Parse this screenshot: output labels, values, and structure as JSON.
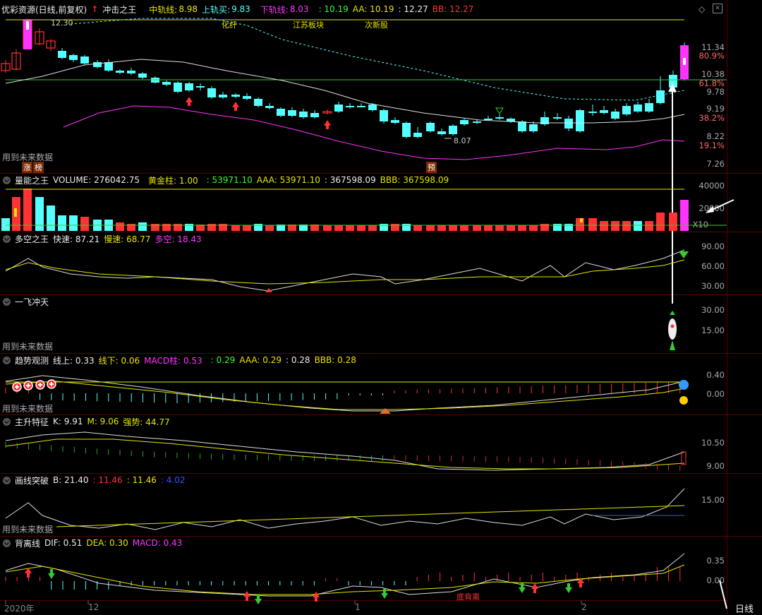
{
  "main": {
    "title": "优彩资源(日线,前复权)",
    "indicator": "冲击之王",
    "mid_label": "中轨线:",
    "mid_val": "8.98",
    "up_label": "上轨买:",
    "up_val": "9.83",
    "down_label": "下轨线:",
    "down_val": "8.03",
    "v1": ": 10.19",
    "aa": "AA: 10.19",
    "v2": ": 12.27",
    "bb": "BB: 12.27",
    "future_text": "用到未来数据",
    "annot_high": "12.30",
    "annot_low": "8.07",
    "tags": [
      "化纤",
      "江苏板块",
      "次新股"
    ],
    "badge1": "涨",
    "badge2": "榜",
    "badge3": "预",
    "y_labels": [
      "11.34",
      "10.38",
      "9.78",
      "9.19",
      "8.22",
      "7.26"
    ],
    "pct_labels": [
      "80.9%",
      "61.8%",
      "38.2%",
      "19.1%"
    ]
  },
  "volume": {
    "name": "量能之王",
    "vol_label": "VOLUME: 276042.75",
    "gold_label": "黄金柱: 1.00",
    "v1": ": 53971.10",
    "aaa": "AAA: 53971.10",
    "v2": ": 367598.09",
    "bbb": "BBB: 367598.09",
    "y_labels": [
      "40000",
      "20000"
    ],
    "unit": "X10"
  },
  "bullbear": {
    "name": "多空之王",
    "fast": "快速: 87.21",
    "slow": "慢速: 68.77",
    "ls": "多空: 18.43",
    "y_labels": [
      "90.00",
      "60.00",
      "30.00"
    ]
  },
  "rocket": {
    "name": "一飞冲天",
    "future_text": "用到未来数据",
    "y_labels": [
      "30.00",
      "15.00"
    ]
  },
  "trend": {
    "name": "趋势观测",
    "up": "线上: 0.33",
    "down": "线下: 0.06",
    "macd": "MACD柱: 0.53",
    "v1": ": 0.29",
    "aaa": "AAA: 0.29",
    "v2": ": 0.28",
    "bbb": "BBB: 0.28",
    "future_text": "用到未来数据",
    "y_labels": [
      "0.40",
      "0.00"
    ]
  },
  "rise": {
    "name": "主升特征",
    "k": "K: 9.91",
    "m": "M: 9.06",
    "strength": "强势: 44.77",
    "y_labels": [
      "10.50",
      "9.00"
    ]
  },
  "breakout": {
    "name": "画线突破",
    "b": "B: 21.40",
    "v1": ": 11.46",
    "v2": ": 11.46",
    "v3": ": 4.02",
    "future_text": "用到未来数据",
    "y_labels": [
      "15.00"
    ]
  },
  "diverge": {
    "name": "背离线",
    "dif": "DIF: 0.51",
    "dea": "DEA: 0.30",
    "macd": "MACD: 0.43",
    "annot": "底背离",
    "y_labels": [
      "0.35",
      "0.00"
    ]
  },
  "xaxis": {
    "labels": [
      "2020年",
      "12",
      "1",
      "2"
    ]
  },
  "period": "日线",
  "colors": {
    "up": "#ff3333",
    "down": "#54ffff",
    "yellow": "#e6e600",
    "magenta": "#ff33ff",
    "green": "#33cc33",
    "divider": "#5a0000"
  }
}
